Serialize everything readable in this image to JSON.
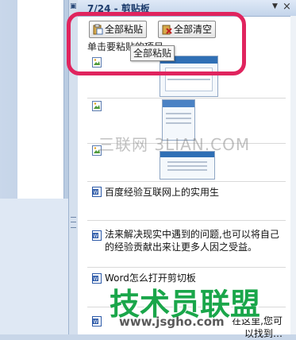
{
  "panel": {
    "title": "7/24 - 剪贴板",
    "dropdown_icon": "chevron-down-icon",
    "close_label": "×"
  },
  "toolbar": {
    "paste_all_label": "全部粘贴",
    "clear_all_label": "全部清空"
  },
  "tooltip": "全部粘贴",
  "list_label": "单击要粘贴的项目",
  "items": [
    {
      "type": "image",
      "icon": "picture-icon"
    },
    {
      "type": "image",
      "icon": "picture-icon"
    },
    {
      "type": "image",
      "icon": "picture-icon"
    },
    {
      "type": "text",
      "icon": "word-icon",
      "text": "百度经验互联网上的实用生"
    },
    {
      "type": "text",
      "icon": "word-icon",
      "text": "法来解决现实中遇到的问题,也可以将自己的经验贡献出来让更多人因之受益。"
    },
    {
      "type": "text",
      "icon": "word-icon",
      "text": "Word怎么打开剪切板"
    },
    {
      "type": "text",
      "icon": "word-icon",
      "text": "在这里,您可以找到…"
    }
  ],
  "watermarks": {
    "top": "三联网 3LIAN.COM",
    "logo": "技术员联盟",
    "url": "www.jsgho.com"
  },
  "colors": {
    "highlight": "#e0245e",
    "titlebar": "#c3d4ea",
    "logo_green": "#1aa64a"
  }
}
